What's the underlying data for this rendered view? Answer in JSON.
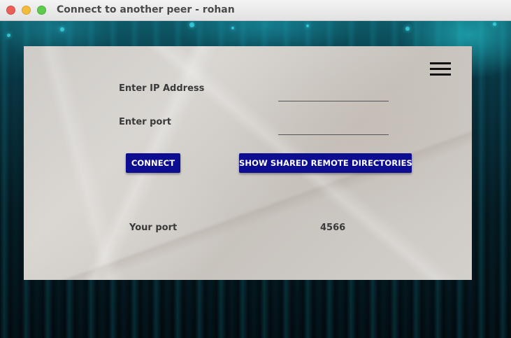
{
  "window": {
    "title": "Connect to another peer - rohan"
  },
  "form": {
    "ip_label": "Enter IP Address",
    "ip_value": "",
    "port_label": "Enter port",
    "port_value": ""
  },
  "buttons": {
    "connect_label": "CONNECT",
    "shared_label": "SHOW SHARED REMOTE DIRECTORIES"
  },
  "info": {
    "your_port_label": "Your port",
    "your_port_value": "4566"
  },
  "icons": {
    "menu": "hamburger-menu-icon"
  },
  "colors": {
    "button_bg": "#0d0d91",
    "button_text": "#ffffff",
    "label_text": "#3a3a3a"
  }
}
